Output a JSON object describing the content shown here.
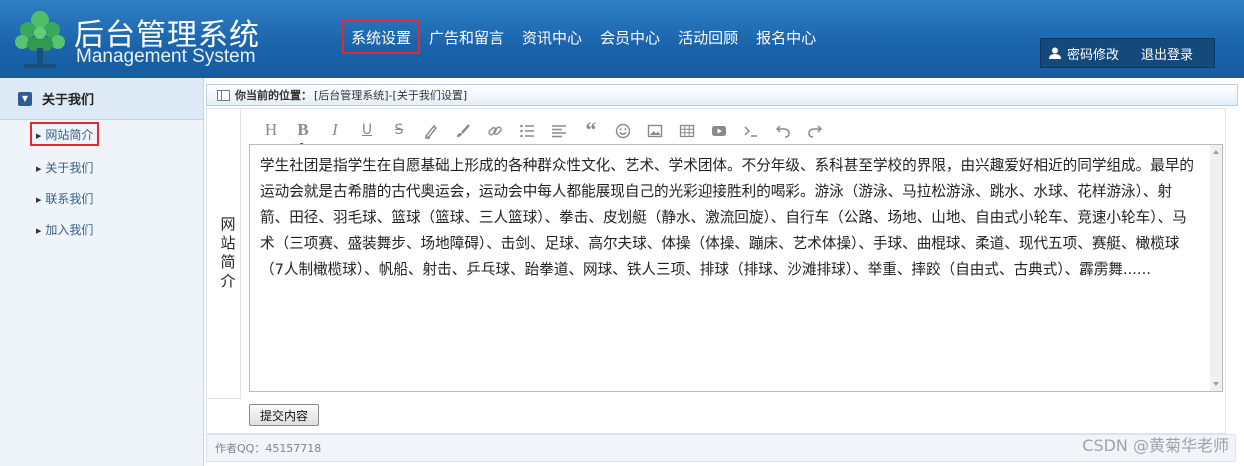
{
  "header": {
    "title": "后台管理系统",
    "subtitle": "Management System",
    "nav": [
      "系统设置",
      "广告和留言",
      "资讯中心",
      "会员中心",
      "活动回顾",
      "报名中心"
    ],
    "selected_nav": "系统设置",
    "password_label": "密码修改",
    "logout_label": "退出登录",
    "brand_color": "#1a63ab"
  },
  "sidebar": {
    "heading": "关于我们",
    "items": [
      "网站简介",
      "关于我们",
      "联系我们",
      "加入我们"
    ],
    "selected": "网站简介"
  },
  "main": {
    "location_label": "你当前的位置：",
    "location_path": "[后台管理系统]-[关于我们设置]",
    "field_label": "网站简介",
    "toolbar_icons": [
      "heading-icon",
      "bold-icon",
      "italic-icon",
      "underline-icon",
      "strikethrough-icon",
      "highlight-icon",
      "brush-icon",
      "link-icon",
      "list-icon",
      "align-icon",
      "quote-icon",
      "emoji-icon",
      "image-icon",
      "table-icon",
      "video-icon",
      "code-icon",
      "undo-icon",
      "redo-icon"
    ],
    "editor_content": "学生社团是指学生在自愿基础上形成的各种群众性文化、艺术、学术团体。不分年级、系科甚至学校的界限，由兴趣爱好相近的同学组成。最早的运动会就是古希腊的古代奥运会，运动会中每人都能展现自己的光彩迎接胜利的喝彩。游泳（游泳、马拉松游泳、跳水、水球、花样游泳）、射箭、田径、羽毛球、篮球（篮球、三人篮球）、拳击、皮划艇（静水、激流回旋）、自行车（公路、场地、山地、自由式小轮车、竞速小轮车）、马术（三项赛、盛装舞步、场地障碍）、击剑、足球、高尔夫球、体操（体操、蹦床、艺术体操）、手球、曲棍球、柔道、现代五项、赛艇、橄榄球（7人制橄榄球）、帆船、射击、乒乓球、跆拳道、网球、铁人三项、排球（排球、沙滩排球）、举重、摔跤（自由式、古典式）、霹雳舞......",
    "submit_label": "提交内容"
  },
  "footer": {
    "author": "作者QQ：45157718"
  },
  "watermark": "CSDN @黄菊华老师"
}
